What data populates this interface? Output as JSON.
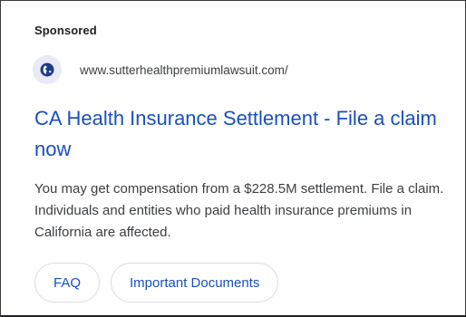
{
  "ad": {
    "sponsored_label": "Sponsored",
    "favicon_icon": "globe-icon",
    "display_url": "www.sutterhealthpremiumlawsuit.com/",
    "headline": "CA Health Insurance Settlement - File a claim now",
    "description": "You may get compensation from a $228.5M settlement. File a claim. Individuals and entities who paid health insurance premiums in California are affected.",
    "sitelinks": [
      {
        "label": "FAQ"
      },
      {
        "label": "Important Documents"
      }
    ]
  },
  "colors": {
    "link_blue": "#1a4fbf",
    "text_gray": "#3c4043",
    "favicon_bg": "#e8eaf6",
    "favicon_fg": "#1f3c88",
    "chip_border": "#dadce0"
  }
}
